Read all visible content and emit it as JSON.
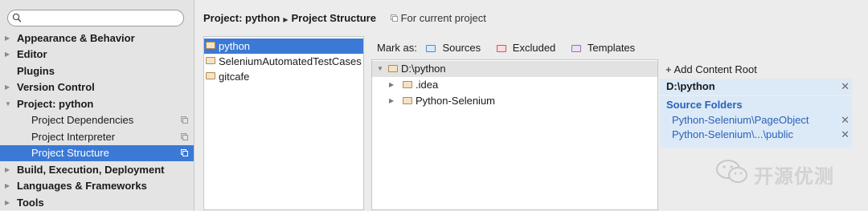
{
  "sidebar": {
    "search_placeholder": "",
    "items": [
      {
        "label": "Appearance & Behavior",
        "bold": true,
        "expandable": true
      },
      {
        "label": "Editor",
        "bold": true,
        "expandable": true
      },
      {
        "label": "Plugins",
        "bold": true,
        "expandable": false
      },
      {
        "label": "Version Control",
        "bold": true,
        "expandable": true
      },
      {
        "label": "Project: python",
        "bold": true,
        "expanded": true
      },
      {
        "label": "Project Dependencies",
        "sub": true
      },
      {
        "label": "Project Interpreter",
        "sub": true
      },
      {
        "label": "Project Structure",
        "sub": true,
        "selected": true
      },
      {
        "label": "Build, Execution, Deployment",
        "bold": true,
        "expandable": true
      },
      {
        "label": "Languages & Frameworks",
        "bold": true,
        "expandable": true
      },
      {
        "label": "Tools",
        "bold": true,
        "expandable": true
      }
    ]
  },
  "header": {
    "project": "Project: python",
    "page": "Project Structure",
    "hint": "For current project"
  },
  "modules": [
    {
      "label": "python",
      "selected": true
    },
    {
      "label": "SeleniumAutomatedTestCases",
      "selected": false
    },
    {
      "label": "gitcafe",
      "selected": false
    }
  ],
  "mark_as": {
    "label": "Mark as:",
    "sources": "Sources",
    "excluded": "Excluded",
    "templates": "Templates",
    "colors": {
      "sources": "#4a8fd0",
      "excluded": "#d9534f",
      "templates": "#9b6bb5"
    }
  },
  "file_tree": {
    "root": "D:\\python",
    "children": [
      ".idea",
      "Python-Selenium"
    ]
  },
  "content_root": {
    "add_label": "+ Add Content Root",
    "path": "D:\\python",
    "source_folders_title": "Source Folders",
    "source_folders": [
      "Python-Selenium\\PageObject",
      "Python-Selenium\\...\\public"
    ],
    "remove_glyph": "✕"
  },
  "watermark": {
    "text": "开源优测"
  }
}
